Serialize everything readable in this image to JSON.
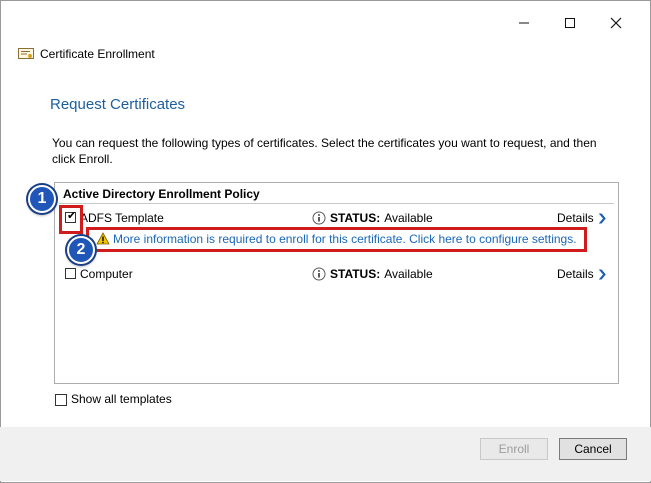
{
  "window": {
    "title": "Certificate Enrollment",
    "controls": {
      "minimize": "—",
      "maximize": "☐",
      "close": "✕"
    }
  },
  "page": {
    "heading": "Request Certificates",
    "description": "You can request the following types of certificates. Select the certificates you want to request, and then click Enroll."
  },
  "policy": {
    "name": "Active Directory Enrollment Policy",
    "certificates": [
      {
        "name": "ADFS Template",
        "checked": true,
        "status_key": "STATUS:",
        "status_value": "Available",
        "details_label": "Details",
        "warning_text": "More information is required to enroll for this certificate. Click here to configure settings."
      },
      {
        "name": "Computer",
        "checked": false,
        "status_key": "STATUS:",
        "status_value": "Available",
        "details_label": "Details"
      }
    ]
  },
  "show_all": {
    "label": "Show all templates",
    "checked": false
  },
  "buttons": {
    "enroll": "Enroll",
    "cancel": "Cancel"
  },
  "annotations": {
    "badge1": "1",
    "badge2": "2"
  },
  "colors": {
    "heading": "#1c5e9e",
    "link": "#1a67b8",
    "annotation_red": "#d01c1c",
    "badge_blue": "#1f56b8"
  }
}
